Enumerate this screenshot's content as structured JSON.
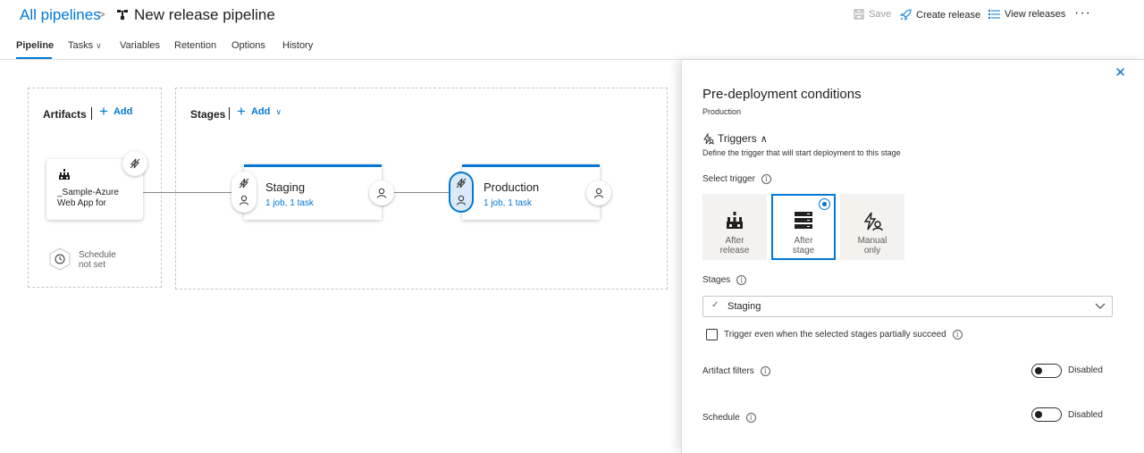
{
  "header": {
    "breadcrumb_link": "All pipelines",
    "breadcrumb_separator": ">",
    "pipeline_title": "New release pipeline",
    "save_label": "Save",
    "create_release_label": "Create release",
    "view_releases_label": "View releases",
    "more_label": "···"
  },
  "tabs": [
    {
      "label": "Pipeline",
      "active": true
    },
    {
      "label": "Tasks",
      "has_dropdown": true
    },
    {
      "label": "Variables"
    },
    {
      "label": "Retention"
    },
    {
      "label": "Options"
    },
    {
      "label": "History"
    }
  ],
  "canvas": {
    "artifacts": {
      "title": "Artifacts",
      "add_label": "Add",
      "artifact_name": "_Sample-Azure Web App for",
      "schedule_text": "Schedule not set",
      "schedule_lines": [
        "Schedule",
        "not set"
      ]
    },
    "stages": {
      "title": "Stages",
      "add_label": "Add",
      "items": [
        {
          "name": "Staging",
          "summary": "1 job, 1 task"
        },
        {
          "name": "Production",
          "summary": "1 job, 1 task",
          "selected": true
        }
      ]
    }
  },
  "panel": {
    "close_icon": "close-icon",
    "title": "Pre-deployment conditions",
    "subtitle": "Production",
    "triggers_heading": "Triggers",
    "triggers_description": "Define the trigger that will start deployment to this stage",
    "select_trigger_label": "Select trigger",
    "trigger_options": [
      {
        "line1": "After",
        "line2": "release",
        "selected": false
      },
      {
        "line1": "After",
        "line2": "stage",
        "selected": true
      },
      {
        "line1": "Manual",
        "line2": "only",
        "selected": false
      }
    ],
    "stages_label": "Stages",
    "stages_value": "Staging",
    "partial_succeed_label": "Trigger even when the selected stages partially succeed",
    "artifact_filters_label": "Artifact filters",
    "artifact_filters_state": "Disabled",
    "schedule_label": "Schedule",
    "schedule_state": "Disabled"
  },
  "colors": {
    "accent": "#0078d4",
    "border": "#c8c6c4",
    "selected_fill": "#dbeaf8"
  }
}
